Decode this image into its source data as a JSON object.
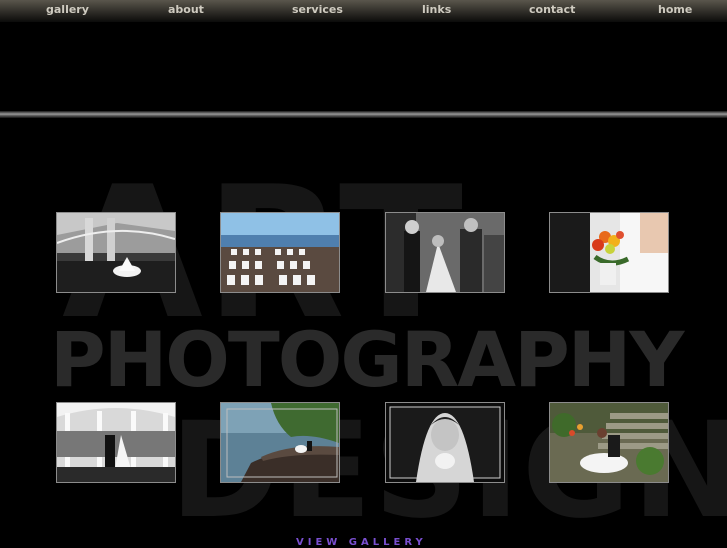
{
  "nav": {
    "items": [
      {
        "label": "gallery"
      },
      {
        "label": "about"
      },
      {
        "label": "services"
      },
      {
        "label": "links"
      },
      {
        "label": "contact"
      },
      {
        "label": "home"
      }
    ]
  },
  "watermark": {
    "line1": "ART",
    "line2": "PHOTOGRAPHY",
    "line3": "DESIGN"
  },
  "gallery": {
    "thumbnails": [
      {
        "subject": "bride under bridge arch"
      },
      {
        "subject": "ceremony chairs by lake"
      },
      {
        "subject": "wedding ceremony vows"
      },
      {
        "subject": "bridal bouquet"
      },
      {
        "subject": "couple in gazebo"
      },
      {
        "subject": "couple on lakeshore rocks"
      },
      {
        "subject": "bride portrait with veil"
      },
      {
        "subject": "couple on garden steps"
      }
    ],
    "view_label": "VIEW GALLERY"
  },
  "colors": {
    "background": "#000000",
    "nav_text": "#cfcbc0",
    "view_link": "#7a4fd0"
  }
}
